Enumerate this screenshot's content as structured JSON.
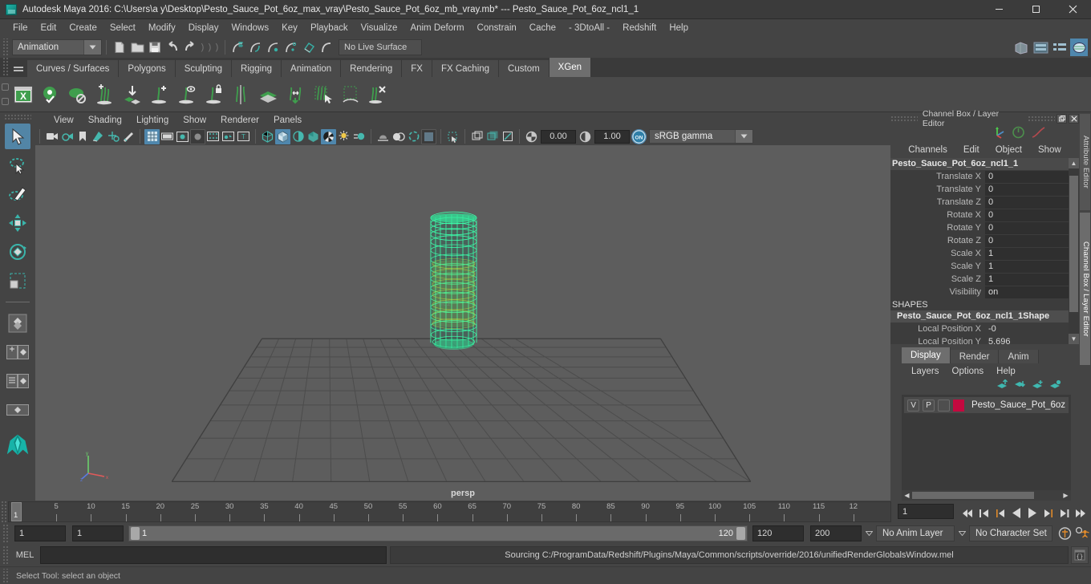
{
  "window": {
    "app_icon": "maya-app-icon",
    "title": "Autodesk Maya 2016: C:\\Users\\a y\\Desktop\\Pesto_Sauce_Pot_6oz_max_vray\\Pesto_Sauce_Pot_6oz_mb_vray.mb*  ---  Pesto_Sauce_Pot_6oz_ncl1_1",
    "minimize": "minimize-icon",
    "maximize": "maximize-icon",
    "close": "close-icon"
  },
  "menubar": {
    "items": [
      "File",
      "Edit",
      "Create",
      "Select",
      "Modify",
      "Display",
      "Windows",
      "Key",
      "Playback",
      "Visualize",
      "Anim Deform",
      "Constrain",
      "Cache",
      "- 3DtoAll -",
      "Redshift",
      "Help"
    ]
  },
  "statusline": {
    "mode": "Animation",
    "live_surface": "No Live Surface",
    "icons": [
      "new-scene-icon",
      "open-scene-icon",
      "save-scene-icon",
      "undo-icon",
      "redo-icon",
      "select-by-hierarchy-icon",
      "select-by-object-icon",
      "select-by-component-icon",
      "snap-to-grid-icon",
      "snap-to-curve-icon",
      "snap-to-point-icon",
      "snap-to-projected-center-icon",
      "snap-to-view-plane-icon",
      "make-live-icon"
    ],
    "right_icons": [
      "show-hide-editors-icon",
      "attribute-editor-toggle-icon",
      "tool-settings-toggle-icon",
      "channel-box-toggle-icon"
    ]
  },
  "shelf": {
    "tabs": [
      "Curves / Surfaces",
      "Polygons",
      "Sculpting",
      "Rigging",
      "Animation",
      "Rendering",
      "FX",
      "FX Caching",
      "Custom",
      "XGen"
    ],
    "active_tab": "XGen",
    "icons": [
      "xgen-window-icon",
      "xgen-preview-on-icon",
      "xgen-preview-off-icon",
      "xgen-add-density-icon",
      "xgen-add-to-patch-icon",
      "xgen-add-guide-icon",
      "xgen-guide-visibility-icon",
      "xgen-lock-guide-icon",
      "xgen-mirror-guide-icon",
      "xgen-patch-icon",
      "xgen-move-guide-icon",
      "xgen-select-guide-icon",
      "xgen-region-select-icon",
      "xgen-delete-guide-icon"
    ]
  },
  "toolbox": {
    "tools": [
      "select-tool",
      "lasso-select-tool",
      "paint-select-tool",
      "move-tool",
      "rotate-tool",
      "scale-tool",
      "last-tool-used",
      "snap-mode-tool",
      "layout-quad-icon",
      "layout-single-perspective-icon",
      "layout-outliner-persp-icon",
      "layout-graph-persp-icon",
      "maya-logo-icon"
    ],
    "active_tool": "select-tool"
  },
  "viewport": {
    "menu": [
      "View",
      "Shading",
      "Lighting",
      "Show",
      "Renderer",
      "Panels"
    ],
    "camera_label": "persp",
    "exposure": "0.00",
    "gamma": "1.00",
    "view_transform": "sRGB gamma",
    "view_transform_toggle": "ON",
    "toolbar_icons": [
      "select-camera-icon",
      "camera-attributes-icon",
      "bookmark-icon",
      "image-plane-icon",
      "two-d-pan-zoom-icon",
      "grease-pencil-icon",
      "grid-toggle-icon",
      "film-gate-icon",
      "resolution-gate-icon",
      "gate-mask-icon",
      "field-chart-icon",
      "safe-action-icon",
      "safe-title-icon",
      "wireframe-icon",
      "smooth-shade-all-icon",
      "shade-flat-icon",
      "use-all-lights-icon",
      "shadows-icon",
      "screen-space-ao-icon",
      "motion-blur-icon",
      "multisample-icon",
      "depth-of-field-icon",
      "isolate-select-icon",
      "xray-icon",
      "xray-joints-icon",
      "xray-active-components-icon",
      "exposure-icon",
      "gamma-icon"
    ],
    "model_name": "Pesto_Sauce_Pot_6oz_ncl1_1",
    "wireframe_color": "#3bffab"
  },
  "channel_box": {
    "panel_title": "Channel Box / Layer Editor",
    "undock_icon": "undock-icon",
    "close_icon": "close-panel-icon",
    "top_icons": [
      "manipulator-axis-icon",
      "channel-speed-icon",
      "channel-curve-icon"
    ],
    "menu": [
      "Channels",
      "Edit",
      "Object",
      "Show"
    ],
    "object_name": "Pesto_Sauce_Pot_6oz_ncl1_1",
    "channels": [
      {
        "label": "Translate X",
        "value": "0"
      },
      {
        "label": "Translate Y",
        "value": "0"
      },
      {
        "label": "Translate Z",
        "value": "0"
      },
      {
        "label": "Rotate X",
        "value": "0"
      },
      {
        "label": "Rotate Y",
        "value": "0"
      },
      {
        "label": "Rotate Z",
        "value": "0"
      },
      {
        "label": "Scale X",
        "value": "1"
      },
      {
        "label": "Scale Y",
        "value": "1"
      },
      {
        "label": "Scale Z",
        "value": "1"
      },
      {
        "label": "Visibility",
        "value": "on"
      }
    ],
    "shapes_header": "SHAPES",
    "shape_name": "Pesto_Sauce_Pot_6oz_ncl1_1Shape",
    "shape_channels": [
      {
        "label": "Local Position X",
        "value": "-0"
      },
      {
        "label": "Local Position Y",
        "value": "5.696"
      }
    ]
  },
  "layer_editor": {
    "tabs": [
      "Display",
      "Render",
      "Anim"
    ],
    "active_tab": "Display",
    "menu": [
      "Layers",
      "Options",
      "Help"
    ],
    "toolbar_icons": [
      "move-layer-up-icon",
      "move-layer-down-icon",
      "create-new-layer-icon",
      "create-layer-from-selected-icon"
    ],
    "layers": [
      {
        "visibility": "V",
        "playback": "P",
        "shading": "",
        "color": "#c4093f",
        "name": "Pesto_Sauce_Pot_6oz"
      }
    ]
  },
  "side_tabs": [
    {
      "label": "Attribute Editor",
      "selected": false
    },
    {
      "label": "Channel Box / Layer Editor",
      "selected": true
    }
  ],
  "timeline": {
    "current_frame_marker": "1",
    "tick_labels": [
      "5",
      "10",
      "15",
      "20",
      "25",
      "30",
      "35",
      "40",
      "45",
      "50",
      "55",
      "60",
      "65",
      "70",
      "75",
      "80",
      "85",
      "90",
      "95",
      "100",
      "105",
      "110",
      "115",
      "12"
    ],
    "current_frame_field": "1",
    "playback_buttons": [
      "go-to-start-icon",
      "step-back-keyframe-icon",
      "step-back-frame-icon",
      "play-backwards-icon",
      "play-forwards-icon",
      "step-forward-frame-icon",
      "step-forward-keyframe-icon",
      "go-to-end-icon"
    ]
  },
  "range": {
    "anim_start": "1",
    "playback_start": "1",
    "slider_start_label": "1",
    "slider_end_label": "120",
    "playback_end": "120",
    "anim_end": "200",
    "anim_layer": "No Anim Layer",
    "character_set": "No Character Set",
    "auto_key_icon": "auto-keyframe-icon",
    "anim_prefs_icon": "animation-preferences-icon"
  },
  "command_line": {
    "language_label": "MEL",
    "input_value": "",
    "response": "Sourcing C:/ProgramData/Redshift/Plugins/Maya/Common/scripts/override/2016/unifiedRenderGlobalsWindow.mel",
    "script_editor_icon": "script-editor-icon"
  },
  "help_line": {
    "text": "Select Tool: select an object"
  }
}
